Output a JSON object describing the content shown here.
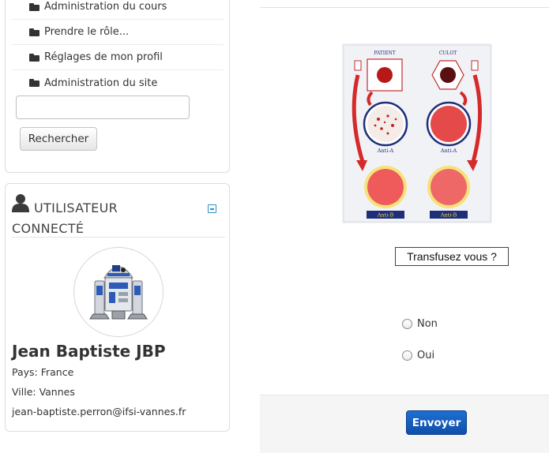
{
  "nav": {
    "items": [
      {
        "label": "Administration du cours"
      },
      {
        "label": "Prendre le rôle..."
      },
      {
        "label": "Réglages de mon profil"
      },
      {
        "label": "Administration du site"
      }
    ],
    "search_value": "",
    "search_button": "Rechercher"
  },
  "user_block": {
    "title": "UTILISATEUR CONNECTÉ",
    "name": "Jean Baptiste JBP",
    "country": "Pays: France",
    "city": "Ville: Vannes",
    "email": "jean-baptiste.perron@ifsi-vannes.fr"
  },
  "question": {
    "image_labels": {
      "patient": "PATIENT",
      "culot": "CULOT",
      "anti_a_left": "Anti-A",
      "anti_a_right": "Anti-A",
      "anti_b_left": "Anti-B",
      "anti_b_right": "Anti-B"
    },
    "prompt": "Transfusez vous ?",
    "options": [
      {
        "label": "Non"
      },
      {
        "label": "Oui"
      }
    ],
    "submit": "Envoyer"
  },
  "colors": {
    "accent": "#2a8fc7",
    "submit_button": "#1459bb",
    "blood_red": "#d42a2a"
  }
}
